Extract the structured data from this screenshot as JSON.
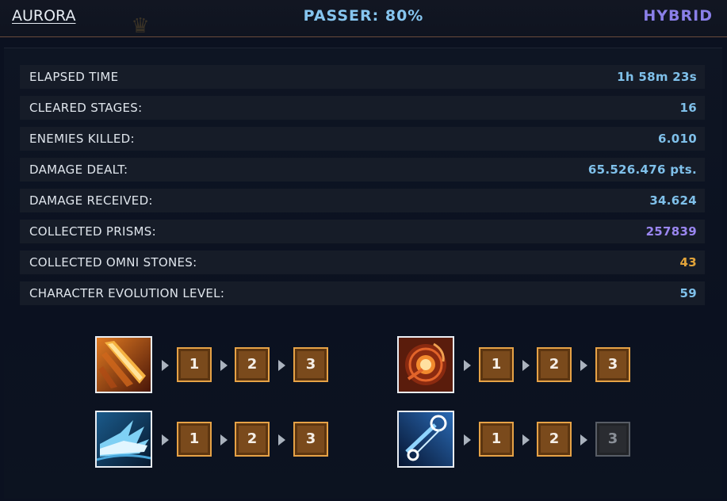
{
  "header": {
    "character": "AURORA",
    "passer": "PASSER: 80%",
    "class": "HYBRID"
  },
  "stats": [
    {
      "label": "ELAPSED TIME",
      "value": "1h 58m 23s",
      "color": "#7fc0ea"
    },
    {
      "label": "CLEARED STAGES:",
      "value": "16",
      "color": "#7fc0ea"
    },
    {
      "label": "ENEMIES KILLED:",
      "value": "6.010",
      "color": "#7fc0ea"
    },
    {
      "label": "DAMAGE DEALT:",
      "value": "65.526.476 pts.",
      "color": "#7fc0ea"
    },
    {
      "label": "DAMAGE RECEIVED:",
      "value": "34.624",
      "color": "#7fc0ea"
    },
    {
      "label": "COLLECTED PRISMS:",
      "value": "257839",
      "color": "#9a86f0"
    },
    {
      "label": "COLLECTED OMNI STONES:",
      "value": "43",
      "color": "#e2a43a"
    },
    {
      "label": "CHARACTER EVOLUTION LEVEL:",
      "value": "59",
      "color": "#7fc0ea"
    }
  ],
  "skills": [
    {
      "icon": "sword-slash-icon",
      "levels": [
        "1",
        "2",
        "3"
      ],
      "unlocked": [
        true,
        true,
        true
      ]
    },
    {
      "icon": "fire-orb-icon",
      "levels": [
        "1",
        "2",
        "3"
      ],
      "unlocked": [
        true,
        true,
        true
      ]
    },
    {
      "icon": "ice-wave-icon",
      "levels": [
        "1",
        "2",
        "3"
      ],
      "unlocked": [
        true,
        true,
        true
      ]
    },
    {
      "icon": "comet-icon",
      "levels": [
        "1",
        "2",
        "3"
      ],
      "unlocked": [
        true,
        true,
        false
      ]
    }
  ]
}
